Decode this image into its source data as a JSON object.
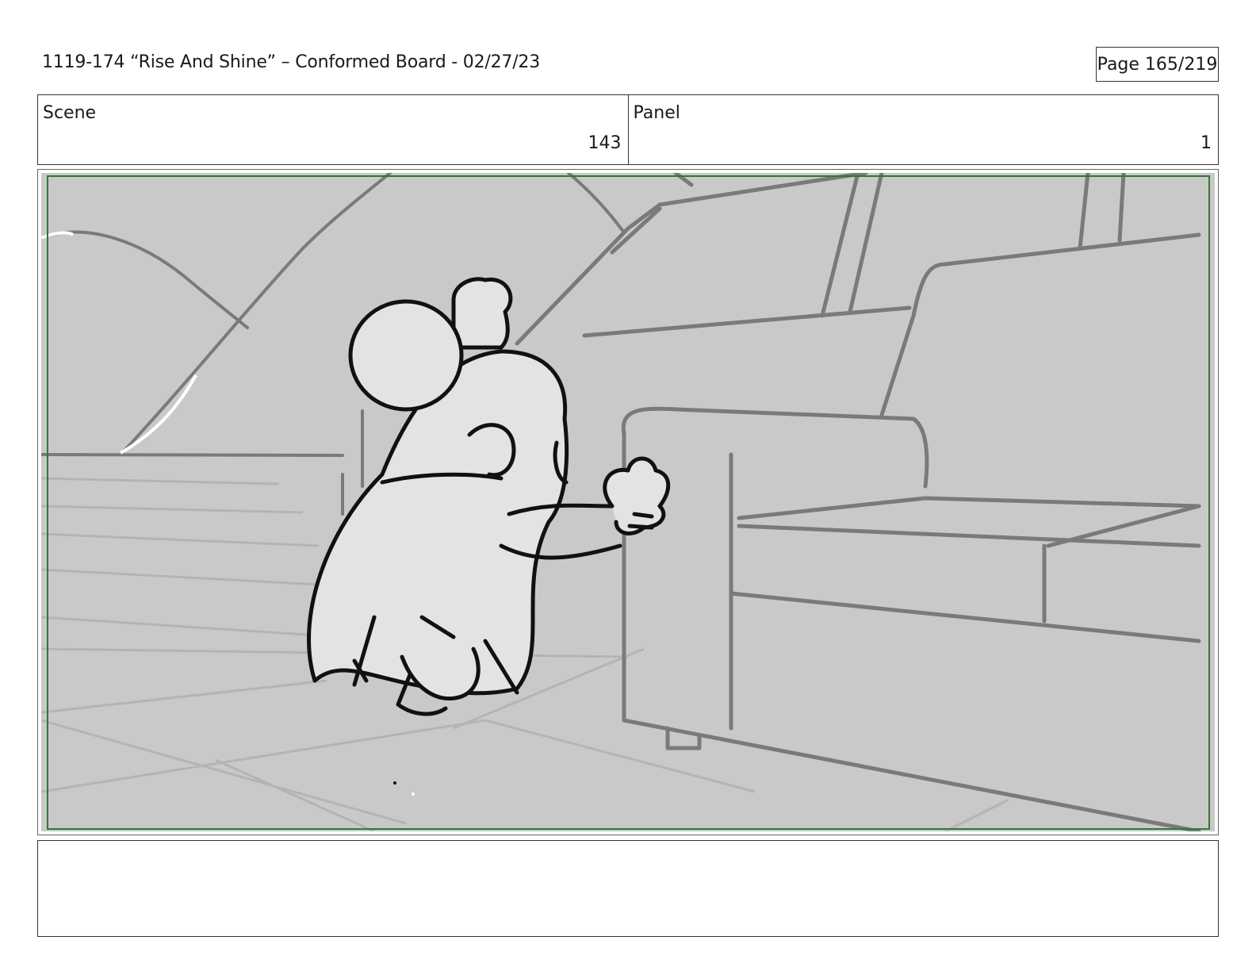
{
  "header": {
    "title": "1119-174 “Rise And Shine” – Conformed Board - 02/27/23",
    "page": "Page 165/219"
  },
  "scene": {
    "label": "Scene",
    "value": "143"
  },
  "panel": {
    "label": "Panel",
    "value": "1"
  },
  "artwork": {
    "subject": "storyboard-sketch",
    "colors": {
      "background": "#c9c9c9",
      "ink": "#111111",
      "layout_lines": "#7a7a7a",
      "safe_frame": "#2e7a2e"
    }
  },
  "notes": {
    "text": ""
  }
}
